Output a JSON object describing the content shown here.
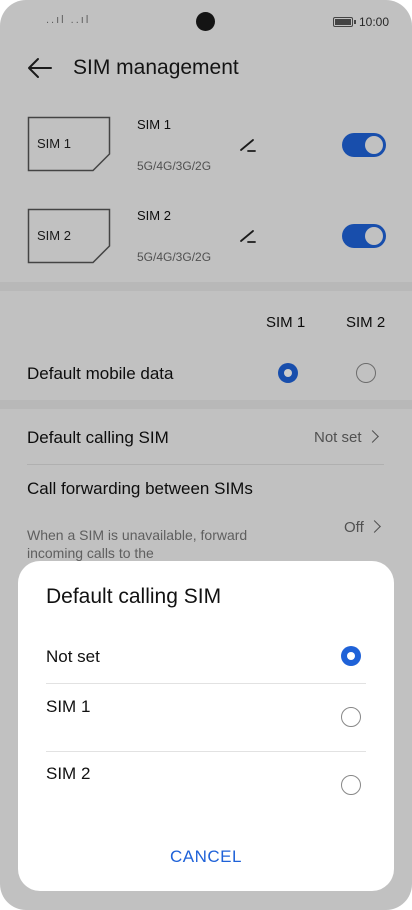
{
  "statusbar": {
    "signals": "..ıl ..ıl",
    "time": "10:00"
  },
  "header": {
    "title": "SIM management"
  },
  "sims": [
    {
      "card_label": "SIM 1",
      "name": "SIM 1",
      "tech": "5G/4G/3G/2G",
      "enabled": true
    },
    {
      "card_label": "SIM 2",
      "name": "SIM 2",
      "tech": "5G/4G/3G/2G",
      "enabled": true
    }
  ],
  "columns": {
    "sim1": "SIM 1",
    "sim2": "SIM 2"
  },
  "default_mobile_data": {
    "label": "Default mobile data",
    "selected": "SIM 1"
  },
  "default_calling": {
    "label": "Default calling SIM",
    "value": "Not set"
  },
  "call_forwarding": {
    "label": "Call forwarding between SIMs",
    "description": "When a SIM is unavailable, forward incoming calls to the",
    "value": "Off"
  },
  "dialog": {
    "title": "Default calling SIM",
    "options": [
      {
        "label": "Not set",
        "selected": true
      },
      {
        "label": "SIM 1",
        "selected": false
      },
      {
        "label": "SIM 2",
        "selected": false
      }
    ],
    "cancel_label": "CANCEL"
  },
  "colors": {
    "accent": "#1f62d8",
    "background": "#f2f2f2"
  },
  "icons": [
    "back-arrow-icon",
    "edit-icon",
    "chevron-right-icon",
    "battery-icon",
    "signal-icon"
  ]
}
